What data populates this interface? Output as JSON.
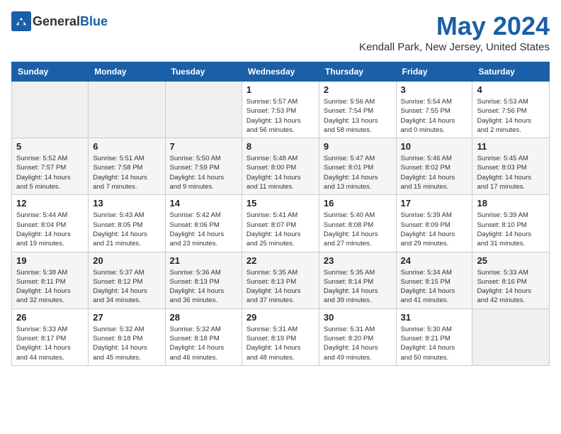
{
  "header": {
    "logo_general": "General",
    "logo_blue": "Blue",
    "month_year": "May 2024",
    "location": "Kendall Park, New Jersey, United States"
  },
  "weekdays": [
    "Sunday",
    "Monday",
    "Tuesday",
    "Wednesday",
    "Thursday",
    "Friday",
    "Saturday"
  ],
  "weeks": [
    [
      {
        "day": "",
        "info": ""
      },
      {
        "day": "",
        "info": ""
      },
      {
        "day": "",
        "info": ""
      },
      {
        "day": "1",
        "info": "Sunrise: 5:57 AM\nSunset: 7:53 PM\nDaylight: 13 hours\nand 56 minutes."
      },
      {
        "day": "2",
        "info": "Sunrise: 5:56 AM\nSunset: 7:54 PM\nDaylight: 13 hours\nand 58 minutes."
      },
      {
        "day": "3",
        "info": "Sunrise: 5:54 AM\nSunset: 7:55 PM\nDaylight: 14 hours\nand 0 minutes."
      },
      {
        "day": "4",
        "info": "Sunrise: 5:53 AM\nSunset: 7:56 PM\nDaylight: 14 hours\nand 2 minutes."
      }
    ],
    [
      {
        "day": "5",
        "info": "Sunrise: 5:52 AM\nSunset: 7:57 PM\nDaylight: 14 hours\nand 5 minutes."
      },
      {
        "day": "6",
        "info": "Sunrise: 5:51 AM\nSunset: 7:58 PM\nDaylight: 14 hours\nand 7 minutes."
      },
      {
        "day": "7",
        "info": "Sunrise: 5:50 AM\nSunset: 7:59 PM\nDaylight: 14 hours\nand 9 minutes."
      },
      {
        "day": "8",
        "info": "Sunrise: 5:48 AM\nSunset: 8:00 PM\nDaylight: 14 hours\nand 11 minutes."
      },
      {
        "day": "9",
        "info": "Sunrise: 5:47 AM\nSunset: 8:01 PM\nDaylight: 14 hours\nand 13 minutes."
      },
      {
        "day": "10",
        "info": "Sunrise: 5:46 AM\nSunset: 8:02 PM\nDaylight: 14 hours\nand 15 minutes."
      },
      {
        "day": "11",
        "info": "Sunrise: 5:45 AM\nSunset: 8:03 PM\nDaylight: 14 hours\nand 17 minutes."
      }
    ],
    [
      {
        "day": "12",
        "info": "Sunrise: 5:44 AM\nSunset: 8:04 PM\nDaylight: 14 hours\nand 19 minutes."
      },
      {
        "day": "13",
        "info": "Sunrise: 5:43 AM\nSunset: 8:05 PM\nDaylight: 14 hours\nand 21 minutes."
      },
      {
        "day": "14",
        "info": "Sunrise: 5:42 AM\nSunset: 8:06 PM\nDaylight: 14 hours\nand 23 minutes."
      },
      {
        "day": "15",
        "info": "Sunrise: 5:41 AM\nSunset: 8:07 PM\nDaylight: 14 hours\nand 25 minutes."
      },
      {
        "day": "16",
        "info": "Sunrise: 5:40 AM\nSunset: 8:08 PM\nDaylight: 14 hours\nand 27 minutes."
      },
      {
        "day": "17",
        "info": "Sunrise: 5:39 AM\nSunset: 8:09 PM\nDaylight: 14 hours\nand 29 minutes."
      },
      {
        "day": "18",
        "info": "Sunrise: 5:39 AM\nSunset: 8:10 PM\nDaylight: 14 hours\nand 31 minutes."
      }
    ],
    [
      {
        "day": "19",
        "info": "Sunrise: 5:38 AM\nSunset: 8:11 PM\nDaylight: 14 hours\nand 32 minutes."
      },
      {
        "day": "20",
        "info": "Sunrise: 5:37 AM\nSunset: 8:12 PM\nDaylight: 14 hours\nand 34 minutes."
      },
      {
        "day": "21",
        "info": "Sunrise: 5:36 AM\nSunset: 8:13 PM\nDaylight: 14 hours\nand 36 minutes."
      },
      {
        "day": "22",
        "info": "Sunrise: 5:35 AM\nSunset: 8:13 PM\nDaylight: 14 hours\nand 37 minutes."
      },
      {
        "day": "23",
        "info": "Sunrise: 5:35 AM\nSunset: 8:14 PM\nDaylight: 14 hours\nand 39 minutes."
      },
      {
        "day": "24",
        "info": "Sunrise: 5:34 AM\nSunset: 8:15 PM\nDaylight: 14 hours\nand 41 minutes."
      },
      {
        "day": "25",
        "info": "Sunrise: 5:33 AM\nSunset: 8:16 PM\nDaylight: 14 hours\nand 42 minutes."
      }
    ],
    [
      {
        "day": "26",
        "info": "Sunrise: 5:33 AM\nSunset: 8:17 PM\nDaylight: 14 hours\nand 44 minutes."
      },
      {
        "day": "27",
        "info": "Sunrise: 5:32 AM\nSunset: 8:18 PM\nDaylight: 14 hours\nand 45 minutes."
      },
      {
        "day": "28",
        "info": "Sunrise: 5:32 AM\nSunset: 8:18 PM\nDaylight: 14 hours\nand 46 minutes."
      },
      {
        "day": "29",
        "info": "Sunrise: 5:31 AM\nSunset: 8:19 PM\nDaylight: 14 hours\nand 48 minutes."
      },
      {
        "day": "30",
        "info": "Sunrise: 5:31 AM\nSunset: 8:20 PM\nDaylight: 14 hours\nand 49 minutes."
      },
      {
        "day": "31",
        "info": "Sunrise: 5:30 AM\nSunset: 8:21 PM\nDaylight: 14 hours\nand 50 minutes."
      },
      {
        "day": "",
        "info": ""
      }
    ]
  ]
}
